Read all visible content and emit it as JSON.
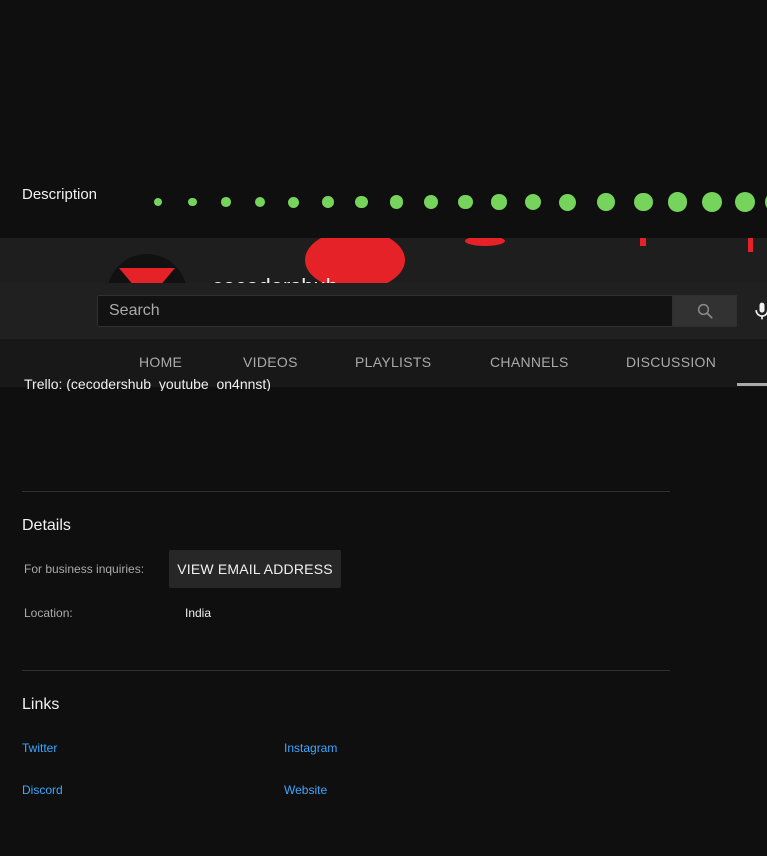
{
  "about": {
    "description_heading": "Description",
    "description_text": "Trello: (cecodershub_youtube_on4nnst)"
  },
  "channel": {
    "name": "cecodershub"
  },
  "search": {
    "placeholder": "Search"
  },
  "tabs": [
    {
      "label": "HOME"
    },
    {
      "label": "VIDEOS"
    },
    {
      "label": "PLAYLISTS"
    },
    {
      "label": "CHANNELS"
    },
    {
      "label": "DISCUSSION"
    }
  ],
  "details": {
    "heading": "Details",
    "business_label": "For business inquiries:",
    "email_button_label": "VIEW EMAIL ADDRESS",
    "location_label": "Location:",
    "location_value": "India"
  },
  "links": {
    "heading": "Links",
    "items": [
      {
        "label": "Twitter"
      },
      {
        "label": "Instagram"
      },
      {
        "label": "Discord"
      },
      {
        "label": "Website"
      }
    ]
  },
  "colors": {
    "background": "#0f0f0f",
    "accent_red": "#e52227",
    "banner_dots": "#76d35b",
    "link": "#3ea6ff"
  },
  "icons": {
    "search_button": "search-icon",
    "mic_button": "microphone-icon"
  }
}
